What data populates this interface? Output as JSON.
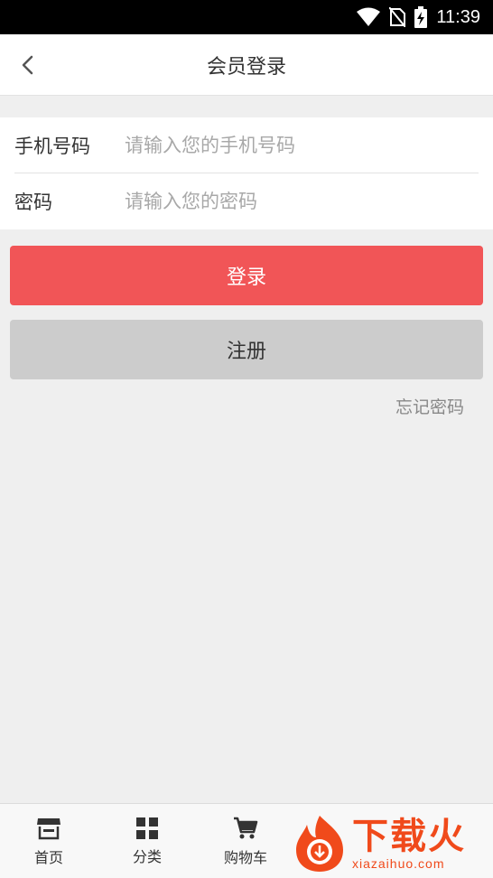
{
  "status_bar": {
    "time": "11:39"
  },
  "header": {
    "title": "会员登录",
    "back_icon": "chevron-left-icon"
  },
  "form": {
    "phone": {
      "label": "手机号码",
      "placeholder": "请输入您的手机号码",
      "value": ""
    },
    "password": {
      "label": "密码",
      "placeholder": "请输入您的密码",
      "value": ""
    }
  },
  "buttons": {
    "login": "登录",
    "register": "注册"
  },
  "forgot_password": "忘记密码",
  "tabbar": {
    "items": [
      {
        "label": "首页",
        "icon": "storefront-icon"
      },
      {
        "label": "分类",
        "icon": "grid-icon"
      },
      {
        "label": "购物车",
        "icon": "cart-icon"
      }
    ]
  },
  "watermark": {
    "text_cn": "下载火",
    "text_en": "xiazaihuo.com"
  },
  "colors": {
    "accent": "#f15557",
    "secondary_button": "#cccccc",
    "watermark": "#f04a1b"
  }
}
